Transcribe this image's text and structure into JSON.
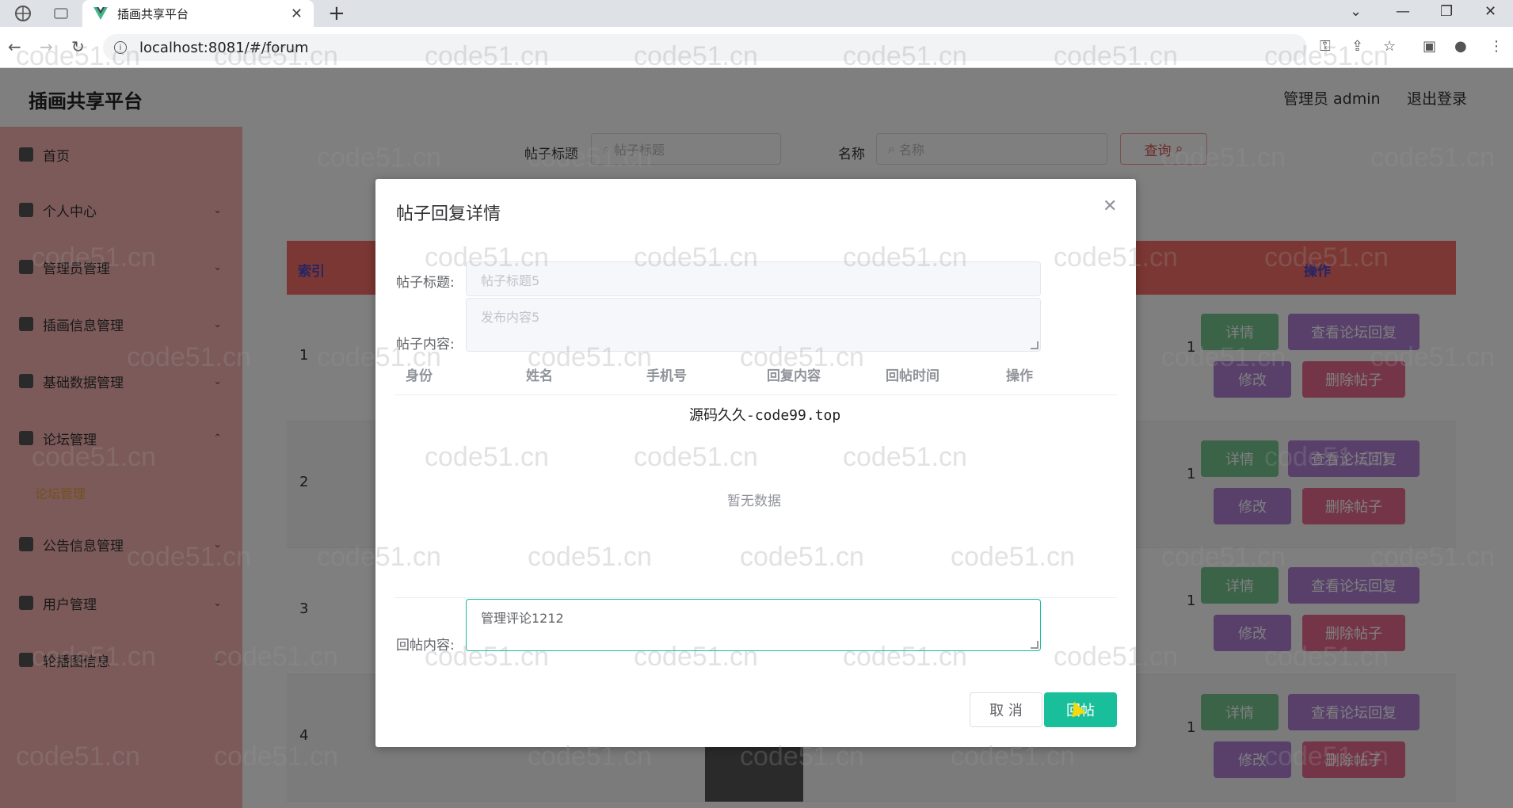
{
  "browser": {
    "tab_title": "插画共享平台",
    "url": "localhost:8081/#/forum",
    "controls": [
      "chevron-down-icon",
      "minimize-icon",
      "restore-icon",
      "close-icon"
    ]
  },
  "app": {
    "brand": "插画共享平台",
    "user_label": "管理员 admin",
    "logout_label": "退出登录"
  },
  "sidebar": {
    "items": [
      {
        "label": "首页",
        "icon": "home-icon"
      },
      {
        "label": "个人中心",
        "icon": "user-icon"
      },
      {
        "label": "管理员管理",
        "icon": "admin-icon"
      },
      {
        "label": "插画信息管理",
        "icon": "clipboard-icon"
      },
      {
        "label": "基础数据管理",
        "icon": "monitor-icon"
      },
      {
        "label": "论坛管理",
        "icon": "chart-icon"
      },
      {
        "label": "公告信息管理",
        "icon": "list-icon"
      },
      {
        "label": "用户管理",
        "icon": "user-icon"
      },
      {
        "label": "轮播图信息",
        "icon": "clipboard-icon"
      }
    ],
    "submenu_active": "论坛管理"
  },
  "search": {
    "title_label": "帖子标题",
    "title_placeholder": "帖子标题",
    "name_label": "名称",
    "name_placeholder": "名称",
    "query_button": "查询"
  },
  "table": {
    "headers": {
      "index": "索引",
      "actions": "操作"
    },
    "rows": [
      {
        "index": "1",
        "count": "1"
      },
      {
        "index": "2",
        "count": "1"
      },
      {
        "index": "3",
        "count": "1"
      },
      {
        "index": "4",
        "count": "1"
      }
    ],
    "buttons": {
      "detail": "详情",
      "view_replies": "查看论坛回复",
      "edit": "修改",
      "delete": "删除帖子"
    }
  },
  "dialog": {
    "title": "帖子回复详情",
    "title_label": "帖子标题:",
    "title_value": "帖子标题5",
    "content_label": "帖子内容:",
    "content_value": "发布内容5",
    "columns": [
      "身份",
      "姓名",
      "手机号",
      "回复内容",
      "回帖时间",
      "操作"
    ],
    "source_note": "源码久久-code99.top",
    "empty_text": "暂无数据",
    "reply_label": "回帖内容:",
    "reply_value": "管理评论1212",
    "cancel_button": "取 消",
    "submit_button": "回帖"
  },
  "watermark": "code51.cn",
  "colors": {
    "sidebar": "#f9b5b3",
    "table_header": "#f66e67",
    "primary": "#19be9b",
    "purple": "#b180d6",
    "pink": "#eb6a93",
    "green": "#74c691"
  }
}
